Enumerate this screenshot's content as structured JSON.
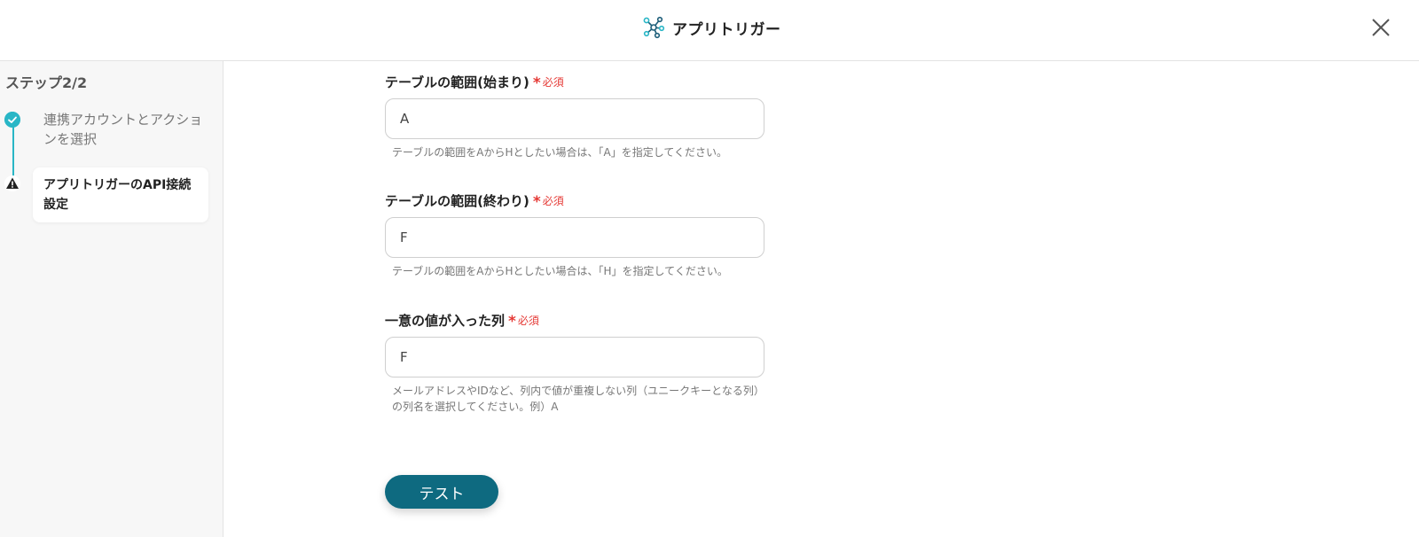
{
  "header": {
    "title": "アプリトリガー",
    "app_icon": "network-nodes-icon",
    "close_icon": "close-icon"
  },
  "sidebar": {
    "step_counter": "ステップ2/2",
    "steps": [
      {
        "label": "連携アカウントとアクションを選択",
        "status": "complete",
        "icon": "check-circle-icon"
      },
      {
        "label": "アプリトリガーのAPI接続設定",
        "status": "warning",
        "icon": "warning-icon"
      }
    ]
  },
  "form": {
    "fields": [
      {
        "label": "テーブルの範囲(始まり)",
        "required_mark": "*",
        "required_text": "必須",
        "value": "A",
        "help": "テーブルの範囲をAからHとしたい場合は、「A」を指定してください。"
      },
      {
        "label": "テーブルの範囲(終わり)",
        "required_mark": "*",
        "required_text": "必須",
        "value": "F",
        "help": "テーブルの範囲をAからHとしたい場合は、「H」を指定してください。"
      },
      {
        "label": "一意の値が入った列",
        "required_mark": "*",
        "required_text": "必須",
        "value": "F",
        "help": "メールアドレスやIDなど、列内で値が重複しない列（ユニークキーとなる列）の列名を選択してください。例）A"
      }
    ],
    "test_button_label": "テスト"
  },
  "colors": {
    "accent": "#29b6c6",
    "button": "#0e6a80",
    "required": "#e53935"
  }
}
